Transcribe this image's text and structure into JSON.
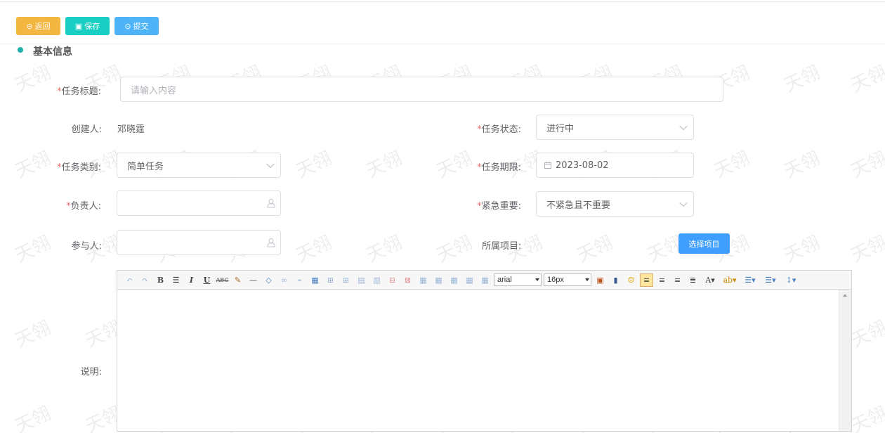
{
  "toolbar": {
    "back_label": "返回",
    "save_label": "保存",
    "submit_label": "提交",
    "colors": {
      "back": "#f3b641",
      "save": "#19cfc4",
      "submit": "#4eb4f7"
    }
  },
  "section": {
    "title": "基本信息"
  },
  "watermark": "天翎",
  "form": {
    "task_title": {
      "label": "任务标题:",
      "required_mark": "*",
      "placeholder": "请输入内容"
    },
    "creator": {
      "label": "创建人:",
      "value": "邓晓霆"
    },
    "task_status": {
      "label": "任务状态:",
      "required_mark": "*",
      "value": "进行中"
    },
    "task_type": {
      "label": "任务类别:",
      "required_mark": "*",
      "value": "简单任务"
    },
    "deadline": {
      "label": "任务期限:",
      "required_mark": "*",
      "value": "2023-08-02"
    },
    "owner": {
      "label": "负责人:",
      "required_mark": "*",
      "value": ""
    },
    "priority": {
      "label": "紧急重要:",
      "required_mark": "*",
      "value": "不紧急且不重要"
    },
    "participants": {
      "label": "参与人:",
      "value": ""
    },
    "project": {
      "label": "所属项目:",
      "button_label": "选择项目"
    },
    "description": {
      "label": "说明:"
    }
  },
  "editor": {
    "font_family": "arial",
    "font_size": "16px",
    "icons": [
      "undo-icon",
      "redo-icon",
      "bold-icon",
      "strikethrough-box-icon",
      "italic-icon",
      "underline-icon",
      "abc-icon",
      "format-brush-icon",
      "horizontal-rule-icon",
      "eraser-icon",
      "link-icon",
      "unlink-icon",
      "table-icon",
      "insert-row-icon",
      "insert-col-icon",
      "merge-cells-icon",
      "split-cells-icon",
      "delete-row-icon",
      "delete-col-icon",
      "table-icon-2",
      "table-icon-3",
      "table-icon-4",
      "table-icon-5",
      "table-icon-6",
      "image-icon",
      "video-icon",
      "emoji-icon",
      "align-left-icon",
      "align-center-icon",
      "align-right-icon",
      "justify-icon",
      "font-color-icon",
      "highlight-icon",
      "ordered-list-icon",
      "unordered-list-icon",
      "line-height-icon"
    ]
  }
}
